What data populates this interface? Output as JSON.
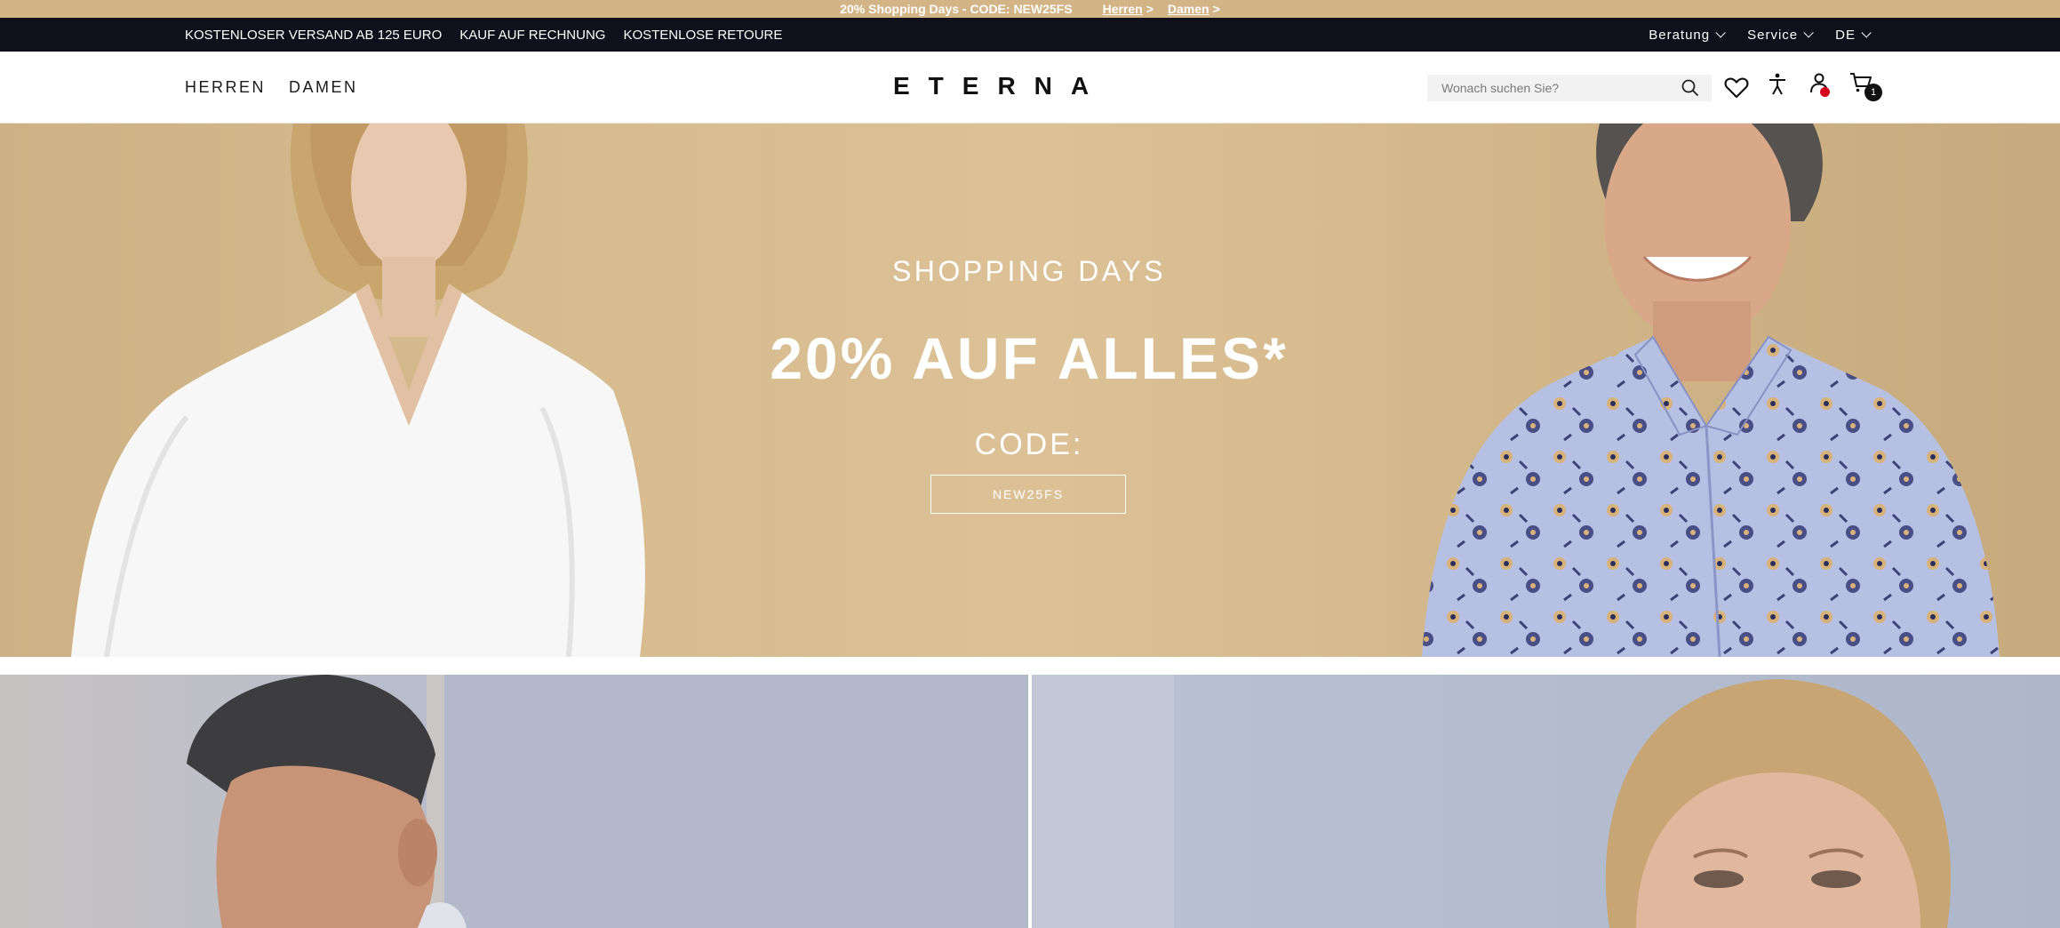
{
  "promo_bar": {
    "text": "20% Shopping Days - CODE: NEW25FS",
    "links": [
      {
        "label": "Herren",
        "arrow": ">"
      },
      {
        "label": "Damen",
        "arrow": ">"
      }
    ]
  },
  "usp_bar": {
    "items": [
      "KOSTENLOSER VERSAND AB 125 EURO",
      "KAUF AUF RECHNUNG",
      "KOSTENLOSE RETOURE"
    ],
    "right": {
      "consulting_label": "Beratung",
      "service_label": "Service",
      "language_label": "DE"
    }
  },
  "header": {
    "nav": [
      "HERREN",
      "DAMEN"
    ],
    "logo_text": "ETERNA",
    "search": {
      "placeholder": "Wonach suchen Sie?",
      "value": ""
    },
    "icons": [
      "heart-icon",
      "accessibility-icon",
      "account-icon",
      "cart-icon"
    ],
    "cart_count": "1"
  },
  "hero": {
    "subtitle": "SHOPPING DAYS",
    "title": "20% AUF ALLES*",
    "code_label": "CODE:",
    "code": "NEW25FS"
  },
  "colors": {
    "promo_bg": "#d3b486",
    "usp_bg": "#0f101c",
    "hero_bg": "#d7bb8f",
    "notification_dot": "#d6001c"
  }
}
